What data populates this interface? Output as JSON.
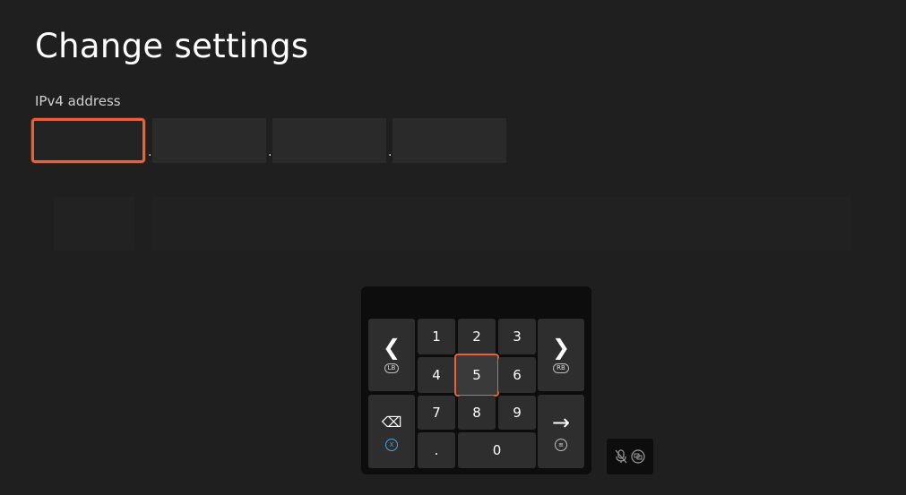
{
  "page": {
    "title": "Change settings"
  },
  "ipv4": {
    "label": "IPv4 address",
    "separator": ".",
    "octets": [
      "",
      "",
      "",
      ""
    ]
  },
  "keypad": {
    "digits": {
      "k1": "1",
      "k2": "2",
      "k3": "3",
      "k4": "4",
      "k5": "5",
      "k6": "6",
      "k7": "7",
      "k8": "8",
      "k9": "9",
      "k0": "0",
      "dot": "."
    },
    "selected": "5",
    "left_glyph": "❮",
    "right_glyph": "❯",
    "left_badge": "LB",
    "right_badge": "RB",
    "backspace_glyph": "⌫",
    "backspace_badge": "X",
    "enter_glyph": "→",
    "enter_badge": "≡"
  },
  "colors": {
    "background": "#1f1f1f",
    "focus": "#e8613a",
    "key": "#2e2e2e",
    "keypad_bg": "#0d0d0d"
  }
}
